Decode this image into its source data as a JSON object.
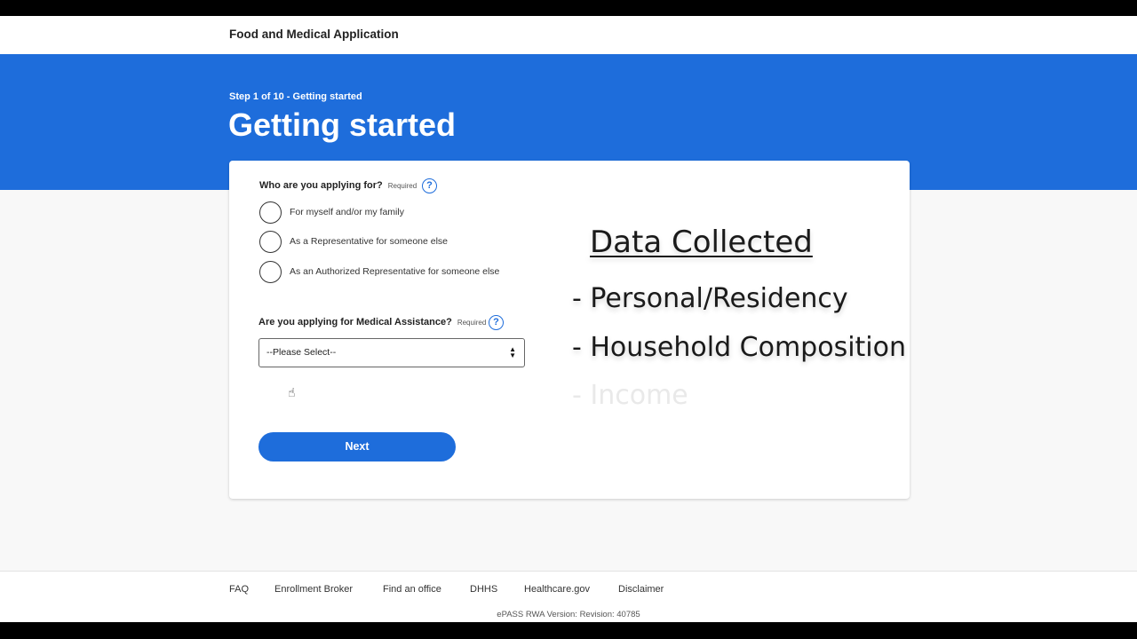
{
  "header": {
    "app_title": "Food and Medical Application"
  },
  "hero": {
    "step_text": "Step 1 of 10 - Getting started",
    "title": "Getting started"
  },
  "form": {
    "q1": {
      "label": "Who are you applying for?",
      "required": "Required",
      "help_icon": "?",
      "options": [
        "For myself and/or my family",
        "As a Representative for someone else",
        "As an Authorized Representative for someone else"
      ]
    },
    "q2": {
      "label": "Are you applying for Medical Assistance?",
      "required": "Required",
      "help_icon": "?",
      "select_value": "--Please Select--"
    },
    "next_label": "Next"
  },
  "overlay": {
    "title": "Data Collected",
    "items": [
      "- Personal/Residency",
      "- Household Composition",
      "- Income"
    ]
  },
  "footer": {
    "links": [
      "FAQ",
      "Enrollment Broker",
      "Find an office",
      "DHHS",
      "Healthcare.gov",
      "Disclaimer"
    ],
    "version": "ePASS RWA Version: Revision: 40785"
  },
  "colors": {
    "brand_blue": "#1e6ddb",
    "page_bg": "#f8f8f8"
  },
  "icons": {
    "help": "question-circle-icon",
    "select": "sort-arrows-icon",
    "cursor": "hand-pointer-icon"
  }
}
